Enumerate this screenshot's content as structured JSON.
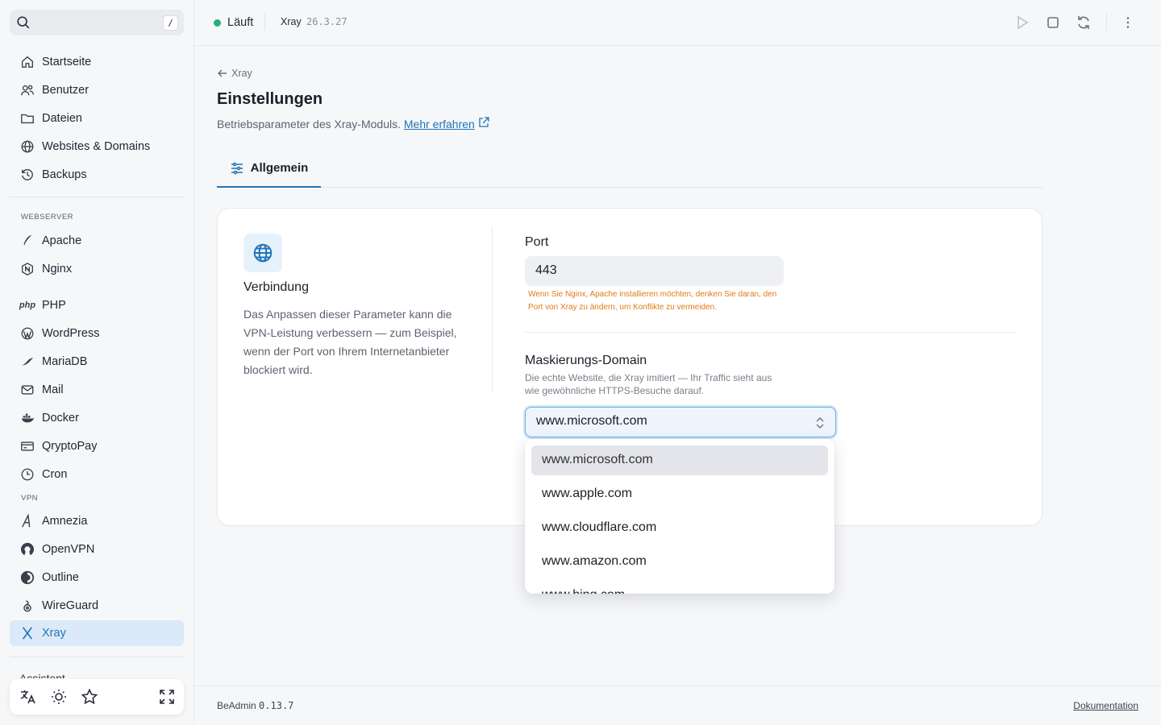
{
  "search": {
    "shortcut": "/"
  },
  "sidebar": {
    "main_items": [
      {
        "label": "Startseite",
        "icon": "home-icon"
      },
      {
        "label": "Benutzer",
        "icon": "users-icon"
      },
      {
        "label": "Dateien",
        "icon": "folder-icon"
      },
      {
        "label": "Websites & Domains",
        "icon": "globe-icon"
      },
      {
        "label": "Backups",
        "icon": "history-icon"
      }
    ],
    "webserver_label": "WEBSERVER",
    "webserver_items": [
      {
        "label": "Apache",
        "icon": "feather-icon"
      },
      {
        "label": "Nginx",
        "icon": "nginx-icon"
      },
      {
        "label": "PHP",
        "icon": "php-icon",
        "icon_text": "php"
      },
      {
        "label": "WordPress",
        "icon": "wordpress-icon"
      },
      {
        "label": "MariaDB",
        "icon": "mariadb-icon"
      },
      {
        "label": "Mail",
        "icon": "mail-icon"
      },
      {
        "label": "Docker",
        "icon": "docker-icon"
      },
      {
        "label": "QryptoPay",
        "icon": "card-icon"
      },
      {
        "label": "Cron",
        "icon": "clock-icon"
      }
    ],
    "vpn_label": "VPN",
    "vpn_items": [
      {
        "label": "Amnezia",
        "icon": "amnezia-icon"
      },
      {
        "label": "OpenVPN",
        "icon": "openvpn-icon"
      },
      {
        "label": "Outline",
        "icon": "outline-icon"
      },
      {
        "label": "WireGuard",
        "icon": "wireguard-icon"
      },
      {
        "label": "Xray",
        "icon": "xray-icon",
        "active": true
      }
    ],
    "cut_item": "Assistent"
  },
  "topbar": {
    "status": "Läuft",
    "status_color": "#22b07d",
    "module": "Xray",
    "version": "26.3.27"
  },
  "page": {
    "back_label": "Xray",
    "title": "Einstellungen",
    "subtitle": "Betriebsparameter des Xray-Moduls.",
    "learn_more": "Mehr erfahren",
    "tab": "Allgemein"
  },
  "card": {
    "title": "Verbindung",
    "description": "Das Anpassen dieser Parameter kann die VPN-Leistung verbessern — zum Beispiel, wenn der Port von Ihrem Internetanbieter blockiert wird.",
    "port_label": "Port",
    "port_value": "443",
    "port_warning": "Wenn Sie Nginx, Apache installieren möchten, denken Sie daran, den Port von Xray zu ändern, um Konflikte zu vermeiden.",
    "domain_label": "Maskierungs-Domain",
    "domain_hint": "Die echte Website, die Xray imitiert — Ihr Traffic sieht aus wie gewöhnliche HTTPS-Besuche darauf.",
    "domain_value": "www.microsoft.com"
  },
  "dropdown": {
    "options": [
      "www.microsoft.com",
      "www.apple.com",
      "www.cloudflare.com",
      "www.amazon.com",
      "www.bing.com"
    ],
    "selected_index": 0
  },
  "footer": {
    "app": "BeAdmin",
    "version": "0.13.7",
    "docs": "Dokumentation"
  },
  "colors": {
    "accent": "#1e73b8",
    "active_bg": "#dbe9f8",
    "warning": "#e07b14"
  }
}
